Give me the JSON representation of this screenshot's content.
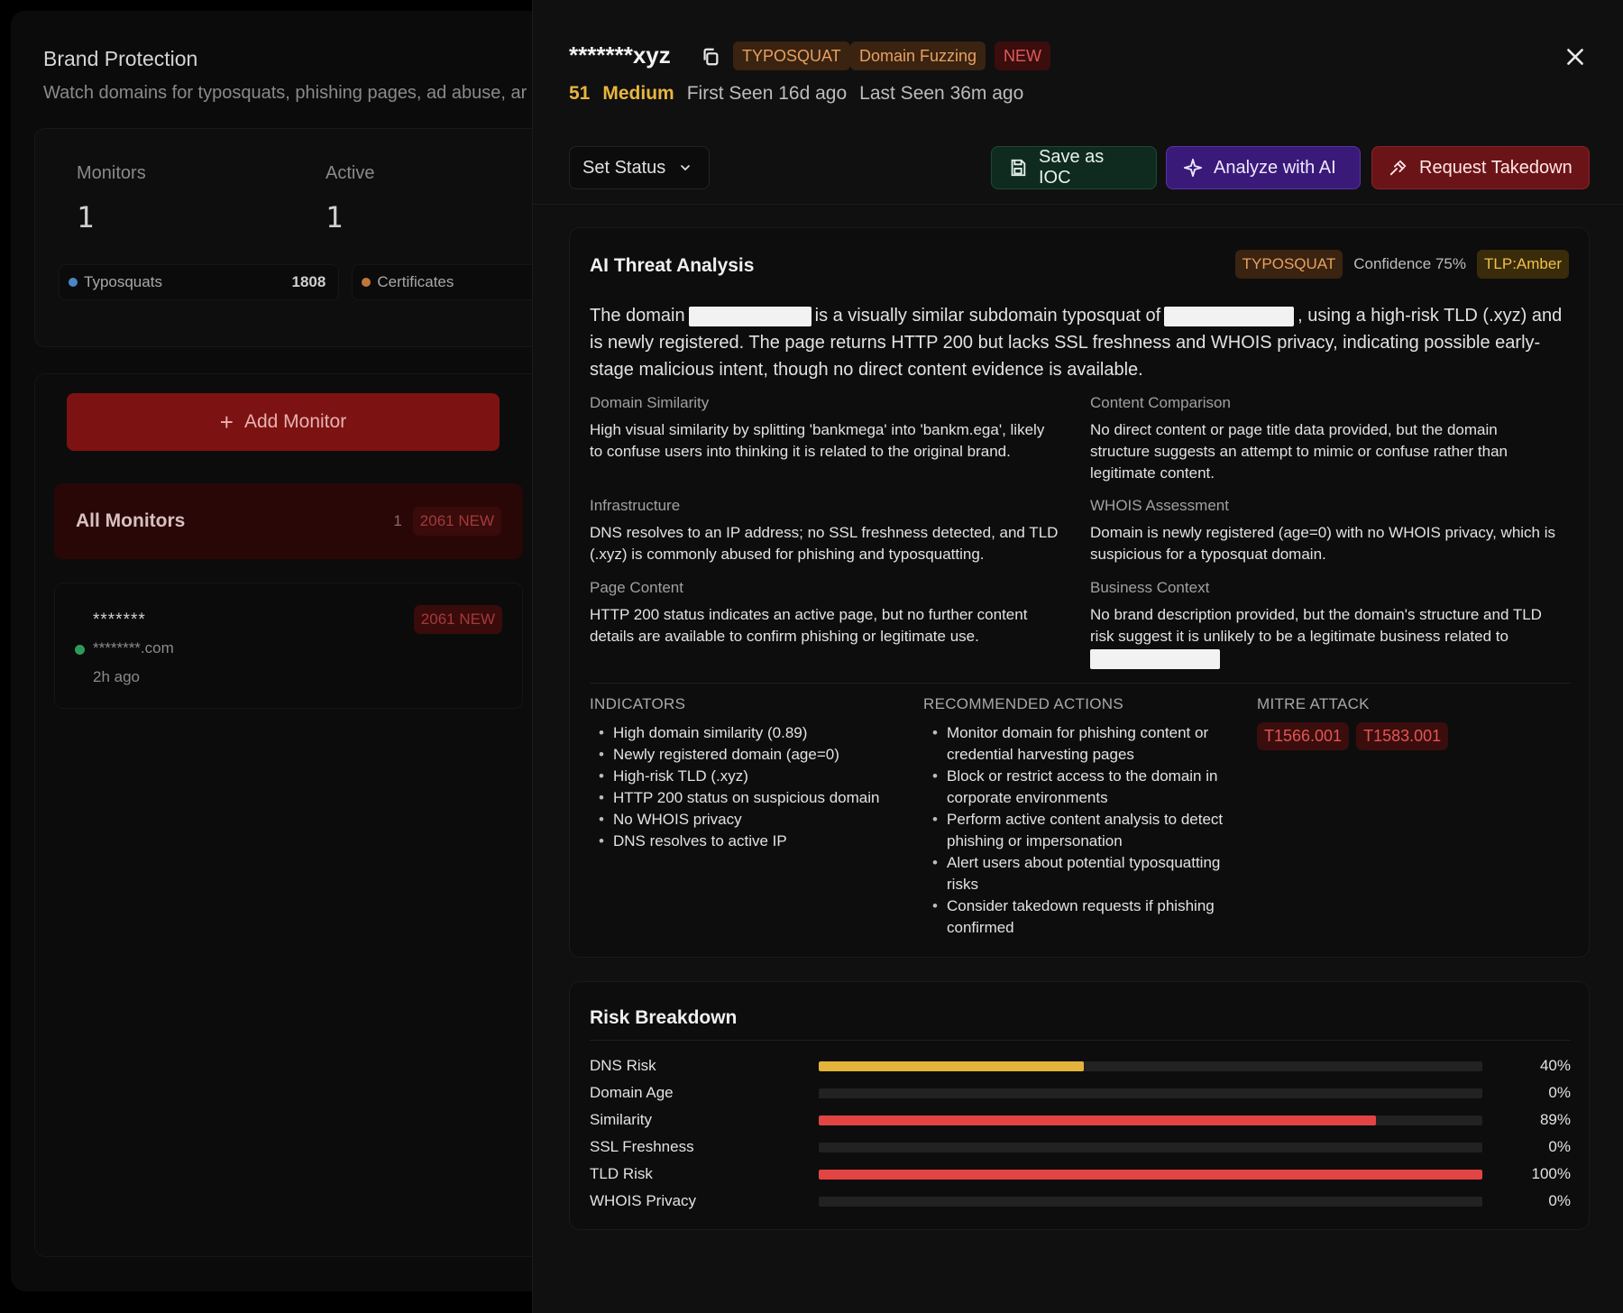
{
  "background": {
    "title": "Brand Protection",
    "subtitle": "Watch domains for typosquats, phishing pages, ad abuse, ar",
    "stats": {
      "monitors_label": "Monitors",
      "monitors_value": "1",
      "active_label": "Active",
      "active_value": "1",
      "typosquats_label": "Typosquats",
      "typosquats_value": "1808",
      "certificates_label": "Certificates"
    },
    "add_monitor_label": "Add Monitor",
    "all_monitors": {
      "label": "All Monitors",
      "count": "1",
      "badge": "2061 NEW"
    },
    "monitor_item": {
      "name": "*******",
      "domain": "********.com",
      "time": "2h ago",
      "badge": "2061 NEW"
    }
  },
  "detail": {
    "domain": "*******xyz",
    "tags": {
      "typosquat": "TYPOSQUAT",
      "fuzzing": "Domain Fuzzing",
      "new": "NEW"
    },
    "score": "51",
    "severity": "Medium",
    "first_seen": "First Seen 16d ago",
    "last_seen": "Last Seen 36m ago",
    "set_status_label": "Set Status",
    "buttons": {
      "save_ioc": "Save as IOC",
      "analyze_ai": "Analyze with AI",
      "takedown": "Request Takedown"
    },
    "ai": {
      "title": "AI Threat Analysis",
      "tag": "TYPOSQUAT",
      "confidence": "Confidence 75%",
      "tlp": "TLP:Amber",
      "summary": {
        "p1": "The domain",
        "p2": "is a visually similar subdomain typosquat of",
        "p3": ", using a high-risk TLD (.xyz) and is newly registered. The page returns HTTP 200 but lacks SSL freshness and WHOIS privacy, indicating possible early-stage malicious intent, though no direct content evidence is available."
      },
      "sections": {
        "domain_similarity": {
          "heading": "Domain Similarity",
          "body": "High visual similarity by splitting 'bankmega' into 'bankm.ega', likely to confuse users into thinking it is related to the original brand."
        },
        "content_comparison": {
          "heading": "Content Comparison",
          "body": "No direct content or page title data provided, but the domain structure suggests an attempt to mimic or confuse rather than legitimate content."
        },
        "infrastructure": {
          "heading": "Infrastructure",
          "body": "DNS resolves to an IP address; no SSL freshness detected, and TLD (.xyz) is commonly abused for phishing and typosquatting."
        },
        "whois": {
          "heading": "WHOIS Assessment",
          "body": "Domain is newly registered (age=0) with no WHOIS privacy, which is suspicious for a typosquat domain."
        },
        "page_content": {
          "heading": "Page Content",
          "body": "HTTP 200 status indicates an active page, but no further content details are available to confirm phishing or legitimate use."
        },
        "business_context": {
          "heading": "Business Context",
          "body": "No brand description provided, but the domain's structure and TLD risk suggest it is unlikely to be a legitimate business related to"
        }
      },
      "indicators": {
        "heading": "INDICATORS",
        "items": [
          "High domain similarity (0.89)",
          "Newly registered domain (age=0)",
          "High-risk TLD (.xyz)",
          "HTTP 200 status on suspicious domain",
          "No WHOIS privacy",
          "DNS resolves to active IP"
        ]
      },
      "recommended": {
        "heading": "RECOMMENDED ACTIONS",
        "items": [
          "Monitor domain for phishing content or credential harvesting pages",
          "Block or restrict access to the domain in corporate environments",
          "Perform active content analysis to detect phishing or impersonation",
          "Alert users about potential typosquatting risks",
          "Consider takedown requests if phishing confirmed"
        ]
      },
      "mitre": {
        "heading": "MITRE ATTACK",
        "items": [
          "T1566.001",
          "T1583.001"
        ]
      }
    },
    "risk": {
      "title": "Risk Breakdown",
      "rows": [
        {
          "label": "DNS Risk",
          "pct_label": "40%",
          "value": 0.4,
          "color": "#e3b33b"
        },
        {
          "label": "Domain Age",
          "pct_label": "0%",
          "value": 0.0,
          "color": "#e24444"
        },
        {
          "label": "Similarity",
          "pct_label": "89%",
          "value": 0.84,
          "color": "#e24444"
        },
        {
          "label": "SSL Freshness",
          "pct_label": "0%",
          "value": 0.0,
          "color": "#e24444"
        },
        {
          "label": "TLD Risk",
          "pct_label": "100%",
          "value": 1.0,
          "color": "#e24444"
        },
        {
          "label": "WHOIS Privacy",
          "pct_label": "0%",
          "value": 0.0,
          "color": "#e24444"
        }
      ]
    }
  }
}
